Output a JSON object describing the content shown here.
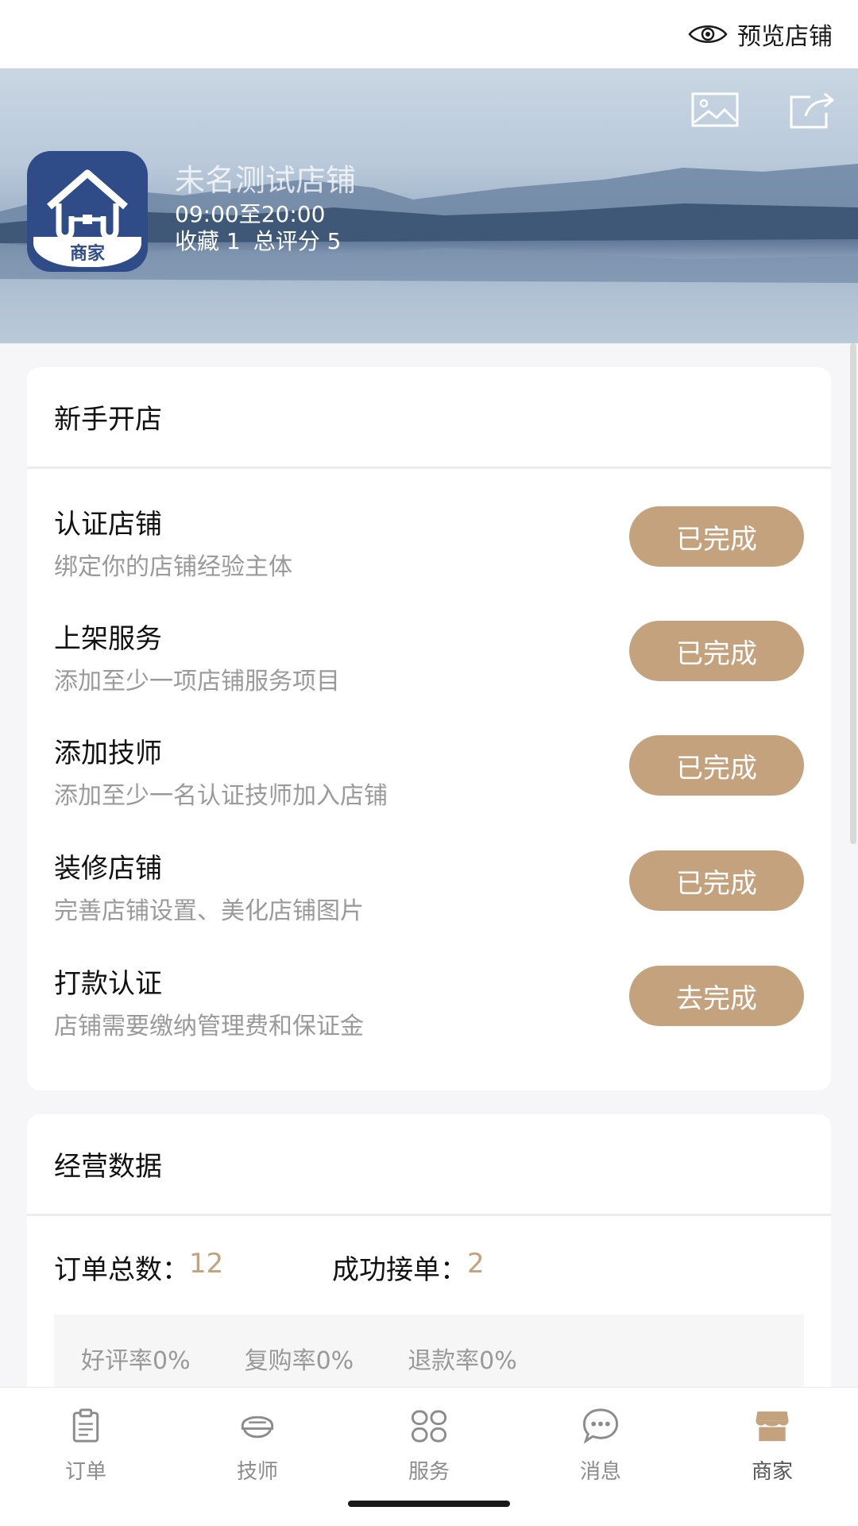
{
  "header": {
    "preview_label": "预览店铺"
  },
  "shop": {
    "logo_tag": "商家",
    "name": "未名测试店铺",
    "hours": "09:00至20:00",
    "favorites": "收藏 1",
    "rating": "总评分 5"
  },
  "onboarding": {
    "title": "新手开店",
    "tasks": [
      {
        "title": "认证店铺",
        "desc": "绑定你的店铺经验主体",
        "button": "已完成"
      },
      {
        "title": "上架服务",
        "desc": "添加至少一项店铺服务项目",
        "button": "已完成"
      },
      {
        "title": "添加技师",
        "desc": "添加至少一名认证技师加入店铺",
        "button": "已完成"
      },
      {
        "title": "装修店铺",
        "desc": "完善店铺设置、美化店铺图片",
        "button": "已完成"
      },
      {
        "title": "打款认证",
        "desc": "店铺需要缴纳管理费和保证金",
        "button": "去完成"
      }
    ]
  },
  "business": {
    "title": "经营数据",
    "total_orders_label": "订单总数：",
    "total_orders_value": "12",
    "accepted_label": "成功接单：",
    "accepted_value": "2",
    "good_rate": "好评率0%",
    "repurchase_rate": "复购率0%",
    "refund_rate": "退款率0%"
  },
  "nav": {
    "items": [
      {
        "label": "订单",
        "icon": "clipboard-icon"
      },
      {
        "label": "技师",
        "icon": "technician-icon"
      },
      {
        "label": "服务",
        "icon": "grid-icon"
      },
      {
        "label": "消息",
        "icon": "chat-bubble-icon"
      },
      {
        "label": "商家",
        "icon": "store-icon"
      }
    ],
    "active_index": 4
  },
  "colors": {
    "accent": "#c4a27d",
    "logo_bg": "#2f4c88",
    "nav_inactive": "#8c8c8c",
    "nav_active": "#c4a27d"
  }
}
